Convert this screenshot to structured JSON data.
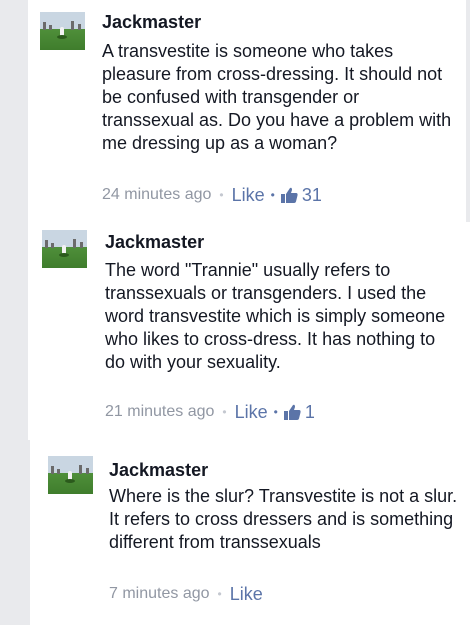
{
  "comments": [
    {
      "author": "Jackmaster",
      "text": "A transvestite is someone who takes pleasure from cross-dressing. It should not be confused with transgender or transsexual as. Do you have a problem with me dressing up as a woman?",
      "time": "24 minutes ago",
      "like_label": "Like",
      "like_count": "31"
    },
    {
      "author": "Jackmaster",
      "text": "The word \"Trannie\" usually refers to transsexuals or transgenders. I used the word transvestite which is simply someone who likes to cross-dress. It has nothing to do with your sexuality.",
      "time": "21 minutes ago",
      "like_label": "Like",
      "like_count": "1"
    },
    {
      "author": "Jackmaster",
      "text": "Where is the slur? Transvestite is not a slur. It refers to cross dressers and is something different from transsexuals",
      "time": "7 minutes ago",
      "like_label": "Like"
    }
  ],
  "separator": "•",
  "colors": {
    "link": "#5b74a8",
    "muted": "#9197a3",
    "text": "#141823",
    "background": "#e9eaed"
  },
  "icons": {
    "like_count": "thumbs-up-icon"
  }
}
